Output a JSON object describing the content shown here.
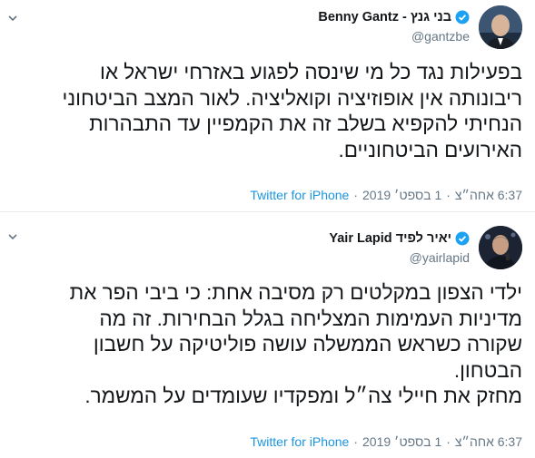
{
  "tweets": [
    {
      "display_name": "בני גנץ - Benny Gantz",
      "handle": "@gantzbe",
      "verified": true,
      "avatar_icon": "portrait-avatar",
      "lines": [
        "בפעילות נגד כל מי שינסה לפגוע באזרחי ישראל או",
        "ריבונותה אין אופוזיציה וקואליציה. לאור המצב הביטחוני",
        "הנחיתי להקפיא בשלב זה את הקמפיין עד התבהרות",
        "האירועים הביטחוניים."
      ],
      "time": "6:37 אחה״צ",
      "date": "1 בספט׳ 2019",
      "source": "Twitter for iPhone"
    },
    {
      "display_name": "יאיר לפיד Yair Lapid",
      "handle": "@yairlapid",
      "verified": true,
      "avatar_icon": "portrait-avatar",
      "lines": [
        "ילדי הצפון במקלטים רק מסיבה אחת: כי ביבי הפר את",
        "מדיניות העמימות המצליחה בגלל הבחירות. זה מה",
        "שקורה כשראש הממשלה עושה פוליטיקה על חשבון",
        "הבטחון.",
        "מחזק את חיילי צה״ל ומפקדיו שעומדים על המשמר."
      ],
      "time": "6:37 אחה״צ",
      "date": "1 בספט׳ 2019",
      "source": "Twitter for iPhone"
    }
  ],
  "colors": {
    "verified_badge": "#1da1f2",
    "link": "#1b95e0",
    "secondary_text": "#657786",
    "primary_text": "#14171a"
  }
}
